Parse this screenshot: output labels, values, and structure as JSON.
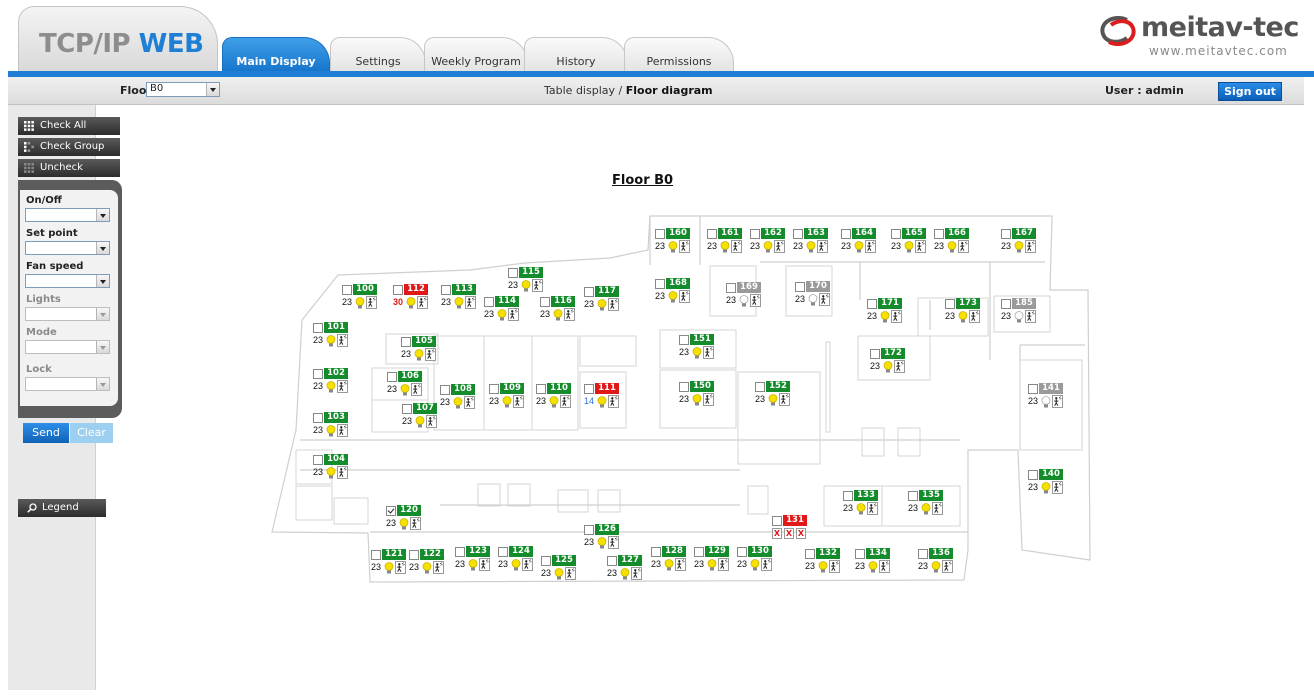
{
  "header": {
    "logo_part1": "TCP/IP",
    "logo_part2": "WEB",
    "tabs": [
      {
        "label": "Main Display",
        "active": true
      },
      {
        "label": "Settings",
        "active": false
      },
      {
        "label": "Weekly Program",
        "active": false
      },
      {
        "label": "History",
        "active": false
      },
      {
        "label": "Permissions",
        "active": false
      }
    ],
    "brand_name": "meitav-tec",
    "brand_url": "www.meitavtec.com"
  },
  "subbar": {
    "floor_label": "Floor",
    "floor_value": "B0",
    "crumb_link": "Table display",
    "crumb_sep": "/",
    "crumb_current": "Floor diagram",
    "user_label": "User : admin",
    "signout_label": "Sign out"
  },
  "sidebar": {
    "check_all": "Check All",
    "check_group": "Check Group",
    "uncheck": "Uncheck",
    "controls": [
      {
        "label": "On/Off",
        "value": "",
        "enabled": true
      },
      {
        "label": "Set point",
        "value": "",
        "enabled": true
      },
      {
        "label": "Fan speed",
        "value": "",
        "enabled": true
      },
      {
        "label": "Lights",
        "value": "",
        "enabled": false
      },
      {
        "label": "Mode",
        "value": "",
        "enabled": false
      },
      {
        "label": "Lock",
        "value": "",
        "enabled": false
      }
    ],
    "send_label": "Send",
    "clear_label": "Clear",
    "legend_label": "Legend"
  },
  "main": {
    "floor_title": "Floor B0"
  },
  "colors": {
    "accent_blue": "#1f7fd6",
    "unit_ok": "#148c2c",
    "unit_alarm": "#e01818",
    "unit_off": "#9a9a9a"
  },
  "units": [
    {
      "id": "160",
      "state": "ok",
      "temp": "23"
    },
    {
      "id": "161",
      "state": "ok",
      "temp": "23"
    },
    {
      "id": "162",
      "state": "ok",
      "temp": "23"
    },
    {
      "id": "163",
      "state": "ok",
      "temp": "23"
    },
    {
      "id": "164",
      "state": "ok",
      "temp": "23"
    },
    {
      "id": "165",
      "state": "ok",
      "temp": "23"
    },
    {
      "id": "166",
      "state": "ok",
      "temp": "23"
    },
    {
      "id": "167",
      "state": "ok",
      "temp": "23"
    },
    {
      "id": "115",
      "state": "ok",
      "temp": "23"
    },
    {
      "id": "168",
      "state": "ok",
      "temp": "23"
    },
    {
      "id": "169",
      "state": "off",
      "temp": "23"
    },
    {
      "id": "170",
      "state": "off",
      "temp": "23"
    },
    {
      "id": "100",
      "state": "ok",
      "temp": "23"
    },
    {
      "id": "112",
      "state": "alarm",
      "temp": "30"
    },
    {
      "id": "113",
      "state": "ok",
      "temp": "23"
    },
    {
      "id": "114",
      "state": "ok",
      "temp": "23"
    },
    {
      "id": "116",
      "state": "ok",
      "temp": "23"
    },
    {
      "id": "117",
      "state": "ok",
      "temp": "23"
    },
    {
      "id": "171",
      "state": "ok",
      "temp": "23"
    },
    {
      "id": "173",
      "state": "ok",
      "temp": "23"
    },
    {
      "id": "185",
      "state": "off",
      "temp": "23"
    },
    {
      "id": "101",
      "state": "ok",
      "temp": "23"
    },
    {
      "id": "105",
      "state": "ok",
      "temp": "23"
    },
    {
      "id": "151",
      "state": "ok",
      "temp": "23"
    },
    {
      "id": "172",
      "state": "ok",
      "temp": "23"
    },
    {
      "id": "102",
      "state": "ok",
      "temp": "23"
    },
    {
      "id": "106",
      "state": "ok",
      "temp": "23"
    },
    {
      "id": "108",
      "state": "ok",
      "temp": "23"
    },
    {
      "id": "109",
      "state": "ok",
      "temp": "23"
    },
    {
      "id": "110",
      "state": "ok",
      "temp": "23"
    },
    {
      "id": "111",
      "state": "alarm",
      "temp": "14"
    },
    {
      "id": "150",
      "state": "ok",
      "temp": "23"
    },
    {
      "id": "152",
      "state": "ok",
      "temp": "23"
    },
    {
      "id": "141",
      "state": "off",
      "temp": "23"
    },
    {
      "id": "107",
      "state": "ok",
      "temp": "23"
    },
    {
      "id": "103",
      "state": "ok",
      "temp": "23"
    },
    {
      "id": "104",
      "state": "ok",
      "temp": "23"
    },
    {
      "id": "140",
      "state": "ok",
      "temp": "23"
    },
    {
      "id": "133",
      "state": "ok",
      "temp": "23"
    },
    {
      "id": "135",
      "state": "ok",
      "temp": "23"
    },
    {
      "id": "120",
      "state": "ok",
      "temp": "23",
      "checked": true
    },
    {
      "id": "131",
      "state": "error",
      "temp": "X"
    },
    {
      "id": "126",
      "state": "ok",
      "temp": "23"
    },
    {
      "id": "121",
      "state": "ok",
      "temp": "23"
    },
    {
      "id": "122",
      "state": "ok",
      "temp": "23"
    },
    {
      "id": "123",
      "state": "ok",
      "temp": "23"
    },
    {
      "id": "124",
      "state": "ok",
      "temp": "23"
    },
    {
      "id": "125",
      "state": "ok",
      "temp": "23"
    },
    {
      "id": "127",
      "state": "ok",
      "temp": "23"
    },
    {
      "id": "128",
      "state": "ok",
      "temp": "23"
    },
    {
      "id": "129",
      "state": "ok",
      "temp": "23"
    },
    {
      "id": "130",
      "state": "ok",
      "temp": "23"
    },
    {
      "id": "132",
      "state": "ok",
      "temp": "23"
    },
    {
      "id": "134",
      "state": "ok",
      "temp": "23"
    },
    {
      "id": "136",
      "state": "ok",
      "temp": "23"
    }
  ]
}
